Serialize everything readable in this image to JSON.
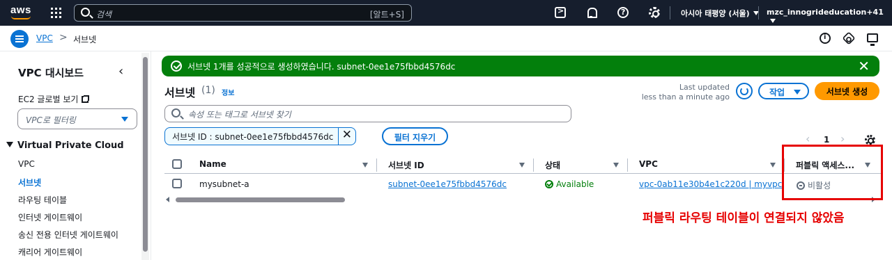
{
  "topnav": {
    "logo": "aws",
    "search_placeholder": "검색",
    "search_shortcut": "[알트+S]",
    "region": "아시아 태평양 (서울)",
    "account": "mzc_innogrideducation+41"
  },
  "breadcrumb": {
    "items": [
      "VPC",
      "서브넷"
    ],
    "separator": ">"
  },
  "sidebar": {
    "title": "VPC 대시보드",
    "close_glyph": "‹",
    "ec2_global_view": "EC2 글로벌 보기",
    "filter_placeholder": "VPC로 필터링",
    "section": "Virtual Private Cloud",
    "items": [
      "VPC",
      "서브넷",
      "라우팅 테이블",
      "인터넷 게이트웨이",
      "송신 전용 인터넷 게이트웨이",
      "캐리어 게이트웨이"
    ],
    "active_index": 1
  },
  "flash": {
    "type": "success",
    "color": "#037f0c",
    "message": "서브넷 1개를 성공적으로 생성하였습니다. subnet-0ee1e75fbbd4576dc",
    "close_glyph": "✕"
  },
  "header": {
    "title": "서브넷",
    "count": "(1)",
    "info": "정보",
    "last_updated_label": "Last updated",
    "last_updated_value": "less than a minute ago",
    "actions_label": "작업",
    "create_label": "서브넷 생성",
    "create_color": "#ff9900"
  },
  "filter": {
    "search_placeholder": "속성 또는 태그로 서브넷 찾기",
    "token": "서브넷 ID : subnet-0ee1e75fbbd4576dc",
    "token_remove": "✕",
    "clear_label": "필터 지우기"
  },
  "pagination": {
    "prev": "‹",
    "page": "1",
    "next": "›"
  },
  "table": {
    "columns": [
      "Name",
      "서브넷 ID",
      "상태",
      "VPC",
      "퍼블릭 액세스..."
    ],
    "rows": [
      {
        "name": "mysubnet-a",
        "subnet_id": "subnet-0ee1e75fbbd4576dc",
        "state": "Available",
        "vpc": "vpc-0ab11e30b4e1c220d | myvpc",
        "public_access": "비활성"
      }
    ]
  },
  "annotation": {
    "text": "퍼블릭 라우팅 테이블이 연결되지 않았음",
    "color": "#e60000"
  }
}
